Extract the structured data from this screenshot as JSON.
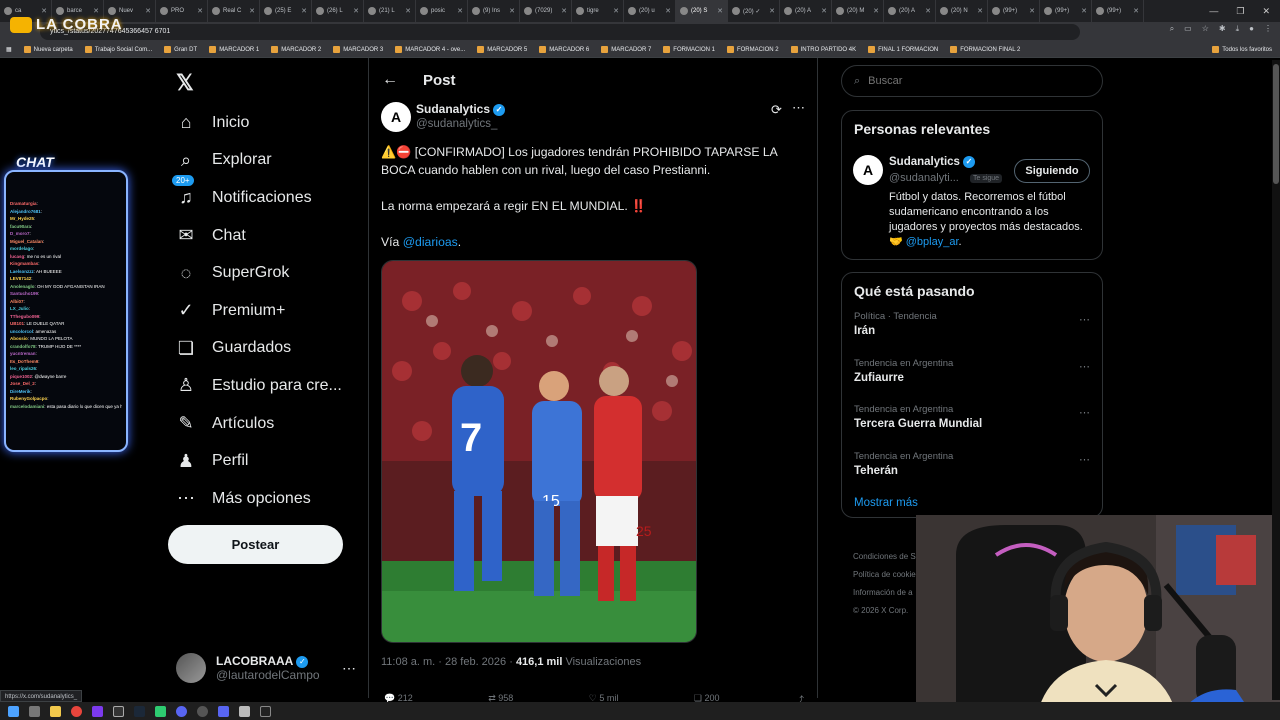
{
  "browser": {
    "tabs": [
      "ca",
      "barce",
      "Nuev",
      "PRO",
      "Real C",
      "(25) E",
      "(26) L",
      "(21) L",
      "posic",
      "(9) Ins",
      "(7029)",
      "tigre",
      "(20) u",
      "(20) S",
      "(20) ✓",
      "(20) A",
      "(20) M",
      "(20) A",
      "(20) N",
      "(99+)",
      "(99+)",
      "(99+)"
    ],
    "active_tab": 13,
    "url": "ytics_/status/2027747645366457 6701",
    "bookmarks": [
      "Nueva carpeta",
      "Trabajo Social Com...",
      "Gran DT",
      "MARCADOR 1",
      "MARCADOR 2",
      "MARCADOR 3",
      "MARCADOR 4 - ove...",
      "MARCADOR 5",
      "MARCADOR 6",
      "MARCADOR 7",
      "FORMACION 1",
      "FORMACION 2",
      "INTRO PARTIDO 4K",
      "FINAL 1 FORMACION",
      "FORMACION FINAL 2"
    ],
    "bookmarks_right": "Todos los favoritos",
    "status_url": "https://x.com/sudanalytics_"
  },
  "overlay": {
    "logo": "LA COBRA",
    "chat_title": "CHAT",
    "chat_lines": [
      {
        "u": "Dramaturgia",
        "m": ""
      },
      {
        "u": "Alejandro7681",
        "m": ""
      },
      {
        "u": "Mr_Hyde25",
        "m": ""
      },
      {
        "u": "facu90ara",
        "m": ""
      },
      {
        "u": "D_moro7",
        "m": ""
      },
      {
        "u": "Miguel_Catalan",
        "m": ""
      },
      {
        "u": "mordelago",
        "m": ""
      },
      {
        "u": "lucasg",
        "m": "me no es un rival"
      },
      {
        "u": "Kingmambas",
        "m": ""
      },
      {
        "u": "Laelsonzzz",
        "m": "AH BUEEEE"
      },
      {
        "u": "LEVII7142",
        "m": ""
      },
      {
        "u": "Anolenaglo",
        "m": "OH MY GOD AFGANISTAN IRAN"
      },
      {
        "u": "Santucho199",
        "m": ""
      },
      {
        "u": "Albi07",
        "m": ""
      },
      {
        "u": "LX_Julio",
        "m": ""
      },
      {
        "u": "TThegubo099",
        "m": ""
      },
      {
        "u": "UB101",
        "m": "LE DUELE QATAR"
      },
      {
        "u": "uncolorcol",
        "m": "amenazas"
      },
      {
        "u": "Abossio",
        "m": "MUNDO LA PELOTA"
      },
      {
        "u": "crandolfo78",
        "m": "TRUMP HIJO DE ****"
      },
      {
        "u": "yucntreman",
        "m": ""
      },
      {
        "u": "Its_DoThem9",
        "m": ""
      },
      {
        "u": "leo_ripals26",
        "m": ""
      },
      {
        "u": "pique1002",
        "m": "@dwayne barre"
      },
      {
        "u": "Jose_Del_2",
        "m": ""
      },
      {
        "u": "DireMerik",
        "m": ""
      },
      {
        "u": "RubenyGolpacpo",
        "m": ""
      },
      {
        "u": "marcelodamiani",
        "m": "esta pasa diario lo que dicen que ya ha sido ella"
      }
    ]
  },
  "nav": {
    "items": [
      {
        "label": "Inicio",
        "icon": "⌂",
        "name": "home"
      },
      {
        "label": "Explorar",
        "icon": "⌕",
        "name": "explore"
      },
      {
        "label": "Notificaciones",
        "icon": "♫",
        "name": "notifications",
        "badge": "20+"
      },
      {
        "label": "Chat",
        "icon": "✉",
        "name": "chat"
      },
      {
        "label": "SuperGrok",
        "icon": "◌",
        "name": "supergrok"
      },
      {
        "label": "Premium+",
        "icon": "✓",
        "name": "premium"
      },
      {
        "label": "Guardados",
        "icon": "❏",
        "name": "bookmarks"
      },
      {
        "label": "Estudio para cre...",
        "icon": "♙",
        "name": "creator-studio"
      },
      {
        "label": "Artículos",
        "icon": "✎",
        "name": "articles"
      },
      {
        "label": "Perfil",
        "icon": "♟",
        "name": "profile"
      },
      {
        "label": "Más opciones",
        "icon": "⋯",
        "name": "more"
      }
    ],
    "post_button": "Postear",
    "account_name": "LACOBRAAA",
    "account_handle": "@lautarodelCampo"
  },
  "post": {
    "header": "Post",
    "author_name": "Sudanalytics",
    "author_handle": "@sudanalytics_",
    "text1": "⚠️⛔ [CONFIRMADO] Los jugadores tendrán PROHIBIDO TAPARSE LA BOCA cuando hablen con un rival, luego del caso Prestianni.",
    "text2": "La norma empezará a regir EN EL MUNDIAL. ‼️",
    "via": "Vía ",
    "via_link": "@diarioas",
    "via_end": ".",
    "time": "11:08 a. m. · 28 feb. 2026 · ",
    "views": "416,1 mil",
    "views_label": " Visualizaciones",
    "actions": [
      "212",
      "958",
      "5 mil",
      "200"
    ]
  },
  "sidebar": {
    "search_placeholder": "Buscar",
    "relevant_title": "Personas relevantes",
    "rel_name": "Sudanalytics",
    "rel_handle": "@sudanalyti...",
    "rel_follows": "Te sigue",
    "rel_button": "Siguiendo",
    "rel_bio": "Fútbol y datos. Recorremos el fútbol sudamericano encontrando a los jugadores y proyectos más destacados. 🤝 ",
    "rel_bio_link": "@bplay_ar",
    "rel_bio_end": ".",
    "trends_title": "Qué está pasando",
    "trends": [
      {
        "ctx": "Política · Tendencia",
        "name": "Irán"
      },
      {
        "ctx": "Tendencia en Argentina",
        "name": "Zufiaurre"
      },
      {
        "ctx": "Tendencia en Argentina",
        "name": "Tercera Guerra Mundial"
      },
      {
        "ctx": "Tendencia en Argentina",
        "name": "Teherán"
      }
    ],
    "show_more": "Mostrar más",
    "footer": [
      "Condiciones de S",
      "Política de cookie",
      "Información de a",
      "© 2026 X Corp."
    ]
  },
  "colors": {
    "accent": "#1d9bf0",
    "chat_border": "#8ab4ff"
  }
}
